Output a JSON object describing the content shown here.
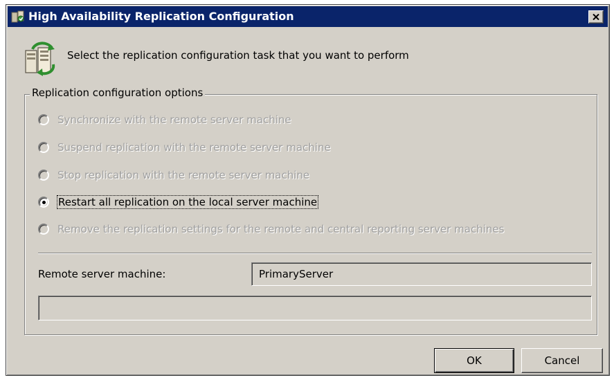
{
  "window": {
    "title": "High Availability Replication Configuration",
    "close_glyph": "✕"
  },
  "header": {
    "instruction": "Select the replication configuration task that you want to perform",
    "icon": "servers-replication-icon"
  },
  "options": {
    "legend": "Replication configuration options",
    "items": [
      {
        "label": "Synchronize with the remote server machine",
        "enabled": false,
        "checked": false
      },
      {
        "label": "Suspend replication with the remote server machine",
        "enabled": false,
        "checked": false
      },
      {
        "label": "Stop replication with the remote server machine",
        "enabled": false,
        "checked": false
      },
      {
        "label": "Restart all replication on the local server machine",
        "enabled": true,
        "checked": true
      },
      {
        "label": "Remove the replication settings for the remote and central reporting server machines",
        "enabled": false,
        "checked": false
      }
    ]
  },
  "remote": {
    "label": "Remote server machine:",
    "value": "PrimaryServer"
  },
  "status": {
    "text": ""
  },
  "buttons": {
    "ok": "OK",
    "cancel": "Cancel"
  },
  "colors": {
    "titlebar": "#0a246a",
    "face": "#d4d0c8",
    "disabled_text": "#a0a0a0"
  }
}
